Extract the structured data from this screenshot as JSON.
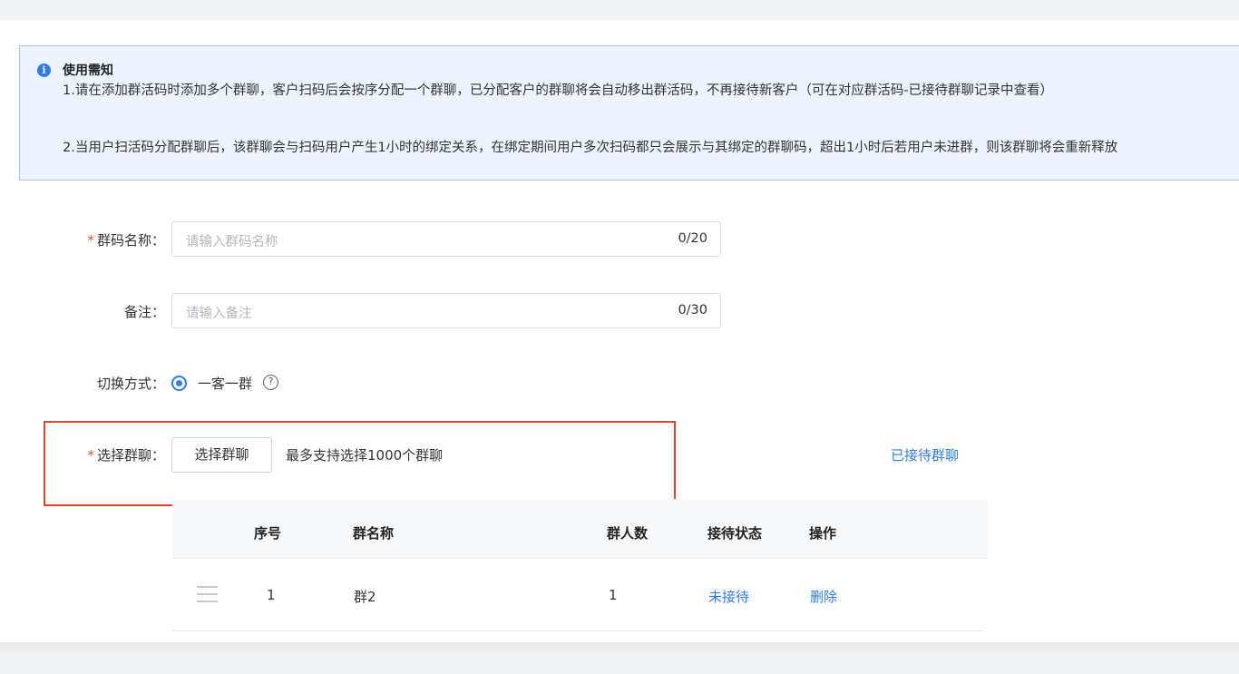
{
  "notice": {
    "title": "使用需知",
    "line1": "1.请在添加群活码时添加多个群聊，客户扫码后会按序分配一个群聊，已分配客户的群聊将会自动移出群活码，不再接待新客户（可在对应群活码-已接待群聊记录中查看）",
    "line2": "2.当用户扫活码分配群聊后，该群聊会与扫码用户产生1小时的绑定关系，在绑定期间用户多次扫码都只会展示与其绑定的群聊码，超出1小时后若用户未进群，则该群聊将会重新释放"
  },
  "form": {
    "required_mark": "*",
    "name_label": "群码名称：",
    "name_placeholder": "请输入群码名称",
    "name_count": "0/20",
    "remark_label": "备注：",
    "remark_placeholder": "请输入备注",
    "remark_count": "0/30",
    "switch_label": "切换方式：",
    "switch_option": "一客一群",
    "help_glyph": "?",
    "group_label": "选择群聊：",
    "select_button": "选择群聊",
    "select_hint": "最多支持选择1000个群聊",
    "received_link": "已接待群聊"
  },
  "table": {
    "headers": [
      "序号",
      "群名称",
      "群人数",
      "接待状态",
      "操作"
    ],
    "rows": [
      {
        "index": "1",
        "name": "群2",
        "members": "1",
        "status": "未接待",
        "action": "删除"
      }
    ]
  },
  "colors": {
    "accent": "#2f7cf0",
    "required": "#e54d42",
    "highlight": "#e0452e",
    "notice_bg": "#edf4ff"
  }
}
